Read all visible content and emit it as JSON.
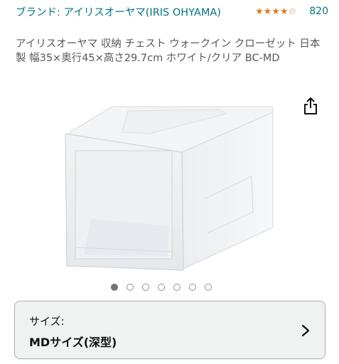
{
  "brand": {
    "link_text": "ブランド: アイリスオーヤマ(IRIS OHYAMA)"
  },
  "rating": {
    "stars": "★★★★☆",
    "review_count": "820",
    "star_color": "#de7921"
  },
  "product": {
    "title": "アイリスオーヤマ 収納 チェスト ウォークイン クローゼット 日本製 幅35×奥行45×高さ29.7cm ホワイト/クリア BC-MD"
  },
  "icons": {
    "share": "share-icon",
    "chevron": "chevron-right-icon"
  },
  "carousel": {
    "total": 7,
    "active_index": 0
  },
  "size_selector": {
    "label": "サイズ:",
    "value": "MDサイズ(深型)"
  },
  "colors": {
    "link": "#007185",
    "text": "#0f1111",
    "muted": "#565959"
  }
}
